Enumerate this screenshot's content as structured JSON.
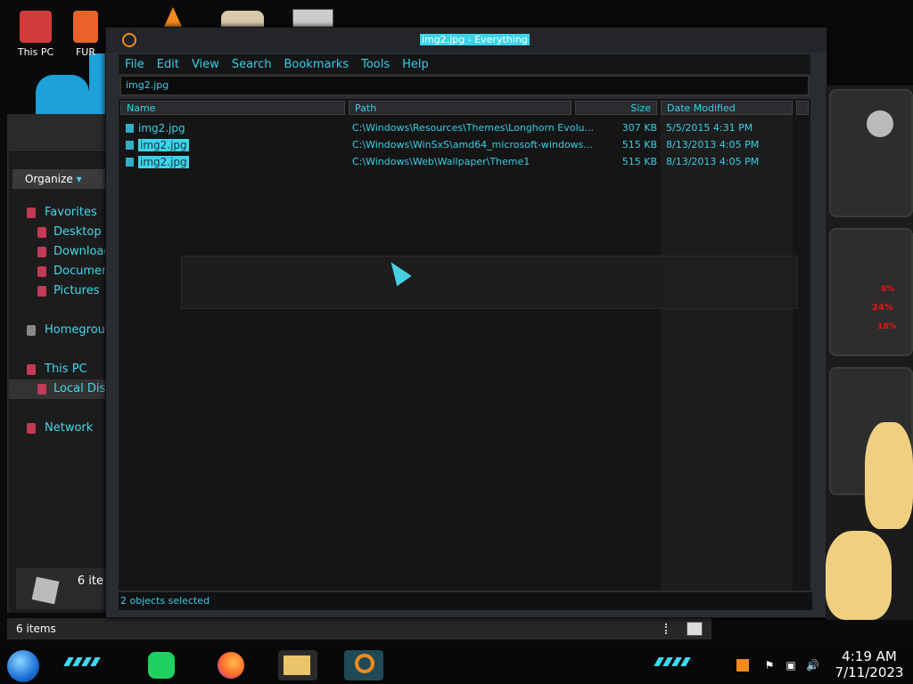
{
  "desktop": {
    "icons": [
      {
        "label": "This PC"
      },
      {
        "label": "FUR"
      }
    ]
  },
  "explorer": {
    "organize_label": "Organize",
    "nav": {
      "favorites": "Favorites",
      "desktop": "Desktop",
      "downloads": "Download",
      "documents": "Document",
      "pictures": "Pictures",
      "homegroup": "Homegroup",
      "this_pc": "This PC",
      "local_disk": "Local Disk",
      "network": "Network"
    },
    "item_count_short": "6 ite",
    "status_text": "6 items"
  },
  "everything": {
    "title": "img2.jpg - Everything",
    "menu": [
      "File",
      "Edit",
      "View",
      "Search",
      "Bookmarks",
      "Tools",
      "Help"
    ],
    "search_value": "img2.jpg",
    "columns": {
      "name": "Name",
      "path": "Path",
      "size": "Size",
      "date": "Date Modified"
    },
    "rows": [
      {
        "name": "img2.jpg",
        "path": "C:\\Windows\\Resources\\Themes\\Longhorn Evolu...",
        "size": "307 KB",
        "date": "5/5/2015 4:31 PM",
        "selected": false
      },
      {
        "name": "img2.jpg",
        "path": "C:\\Windows\\WinSxS\\amd64_microsoft-windows...",
        "size": "515 KB",
        "date": "8/13/2013 4:05 PM",
        "selected": true
      },
      {
        "name": "img2.jpg",
        "path": "C:\\Windows\\Web\\Wallpaper\\Theme1",
        "size": "515 KB",
        "date": "8/13/2013 4:05 PM",
        "selected": true
      }
    ],
    "status": "2 objects selected"
  },
  "widget": {
    "pct1": "8%",
    "pct2": "24%",
    "pct3": "18%"
  },
  "taskbar": {
    "time": "4:19 AM",
    "date": "7/11/2023"
  },
  "colors": {
    "accent": "#3bd4ea",
    "widget_red": "#e11111"
  }
}
